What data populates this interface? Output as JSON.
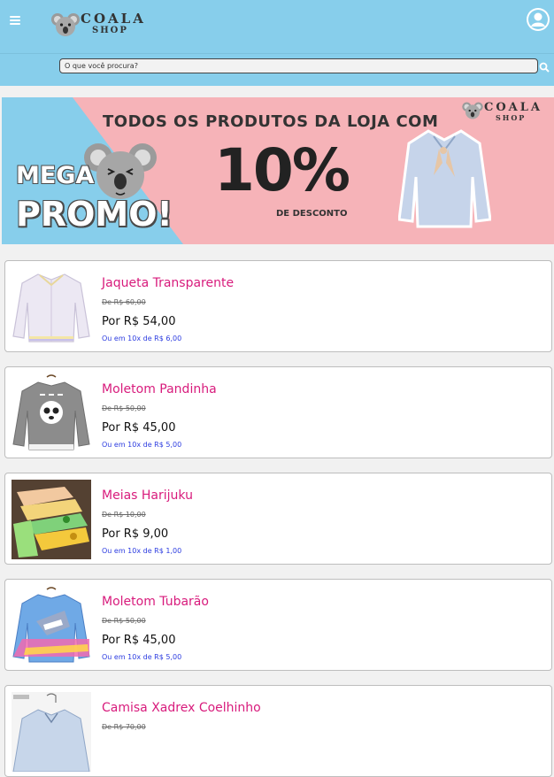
{
  "header": {
    "logo_line1": "COALA",
    "logo_line2": "SHOP",
    "menu_icon": "hamburger-menu-icon",
    "avatar_icon": "user-avatar-icon",
    "bg_color": "#87ceeb"
  },
  "search": {
    "placeholder": "O que você procura?",
    "icon": "search-icon"
  },
  "banner": {
    "headline": "TODOS OS PRODUTOS DA LOJA COM",
    "percent": "10%",
    "discount": "DE DESCONTO",
    "mega": "MEGA",
    "promo": "PROMO!",
    "logo_line1": "COALA",
    "logo_line2": "SHOP",
    "pink": "#f6b3b8",
    "blue": "#87ceeb"
  },
  "products": [
    {
      "name": "Jaqueta Transparente",
      "old_price": "De R$ 60,00",
      "price": "Por R$ 54,00",
      "installments": "Ou em 10x de R$ 6,00"
    },
    {
      "name": "Moletom Pandinha",
      "old_price": "De R$ 50,00",
      "price": "Por R$ 45,00",
      "installments": "Ou em 10x de R$ 5,00"
    },
    {
      "name": "Meias Harijuku",
      "old_price": "De R$ 10,00",
      "price": "Por R$ 9,00",
      "installments": "Ou em 10x de R$ 1,00"
    },
    {
      "name": "Moletom Tubarão",
      "old_price": "De R$ 50,00",
      "price": "Por R$ 45,00",
      "installments": "Ou em 10x de R$ 5,00"
    },
    {
      "name": "Camisa Xadrex Coelhinho",
      "old_price": "De R$ 70,00",
      "price": "",
      "installments": ""
    }
  ],
  "colors": {
    "product_name": "#d81b7c",
    "installments": "#2c3ce0"
  }
}
